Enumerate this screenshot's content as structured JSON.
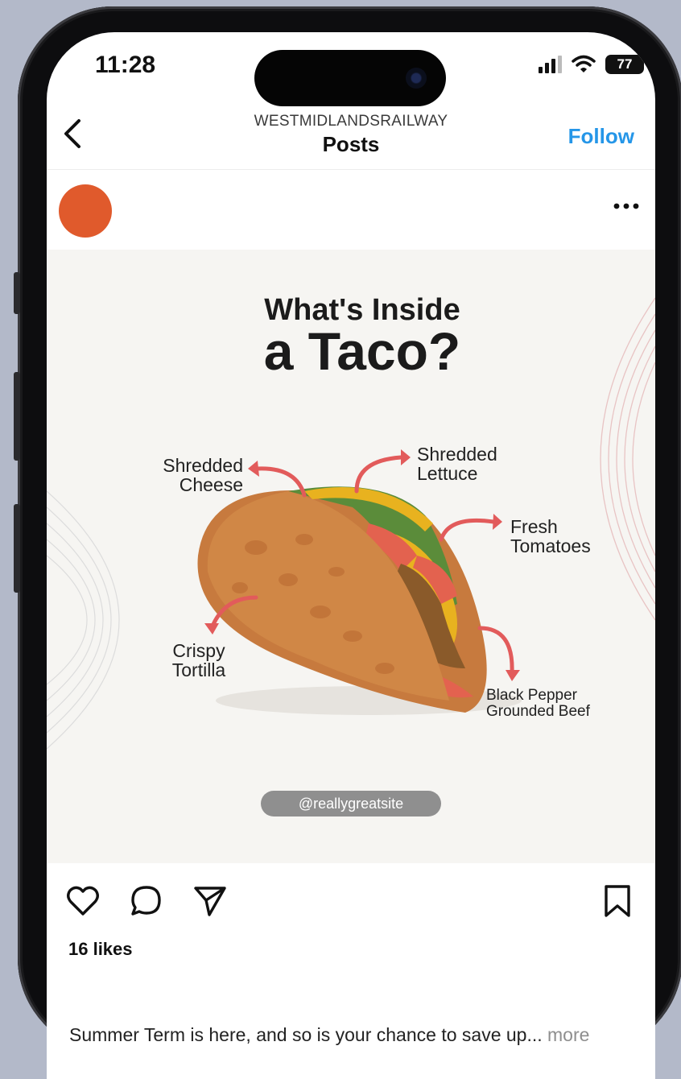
{
  "status_bar": {
    "time": "11:28",
    "battery": "77"
  },
  "header": {
    "account": "WESTMIDLANDSRAILWAY",
    "title": "Posts",
    "follow_label": "Follow"
  },
  "post": {
    "image": {
      "title_line1": "What's Inside",
      "title_line2": "a Taco?",
      "labels": {
        "cheese_l1": "Shredded",
        "cheese_l2": "Cheese",
        "lettuce_l1": "Shredded",
        "lettuce_l2": "Lettuce",
        "tomatoes_l1": "Fresh",
        "tomatoes_l2": "Tomatoes",
        "tortilla_l1": "Crispy",
        "tortilla_l2": "Tortilla",
        "beef_l1": "Black Pepper",
        "beef_l2": "Grounded Beef"
      },
      "handle": "@reallygreatsite"
    },
    "likes": "16 likes",
    "caption": "Summer Term is here, and so is your chance to save up...",
    "caption_more": "more"
  },
  "icons": {
    "back": "chevron-left-icon",
    "options": "more-horizontal-icon",
    "like": "heart-icon",
    "comment": "comment-icon",
    "share": "send-icon",
    "save": "bookmark-icon"
  },
  "colors": {
    "accent": "#2596e8",
    "avatar": "#e05a2c",
    "arrow": "#e25b5b"
  }
}
